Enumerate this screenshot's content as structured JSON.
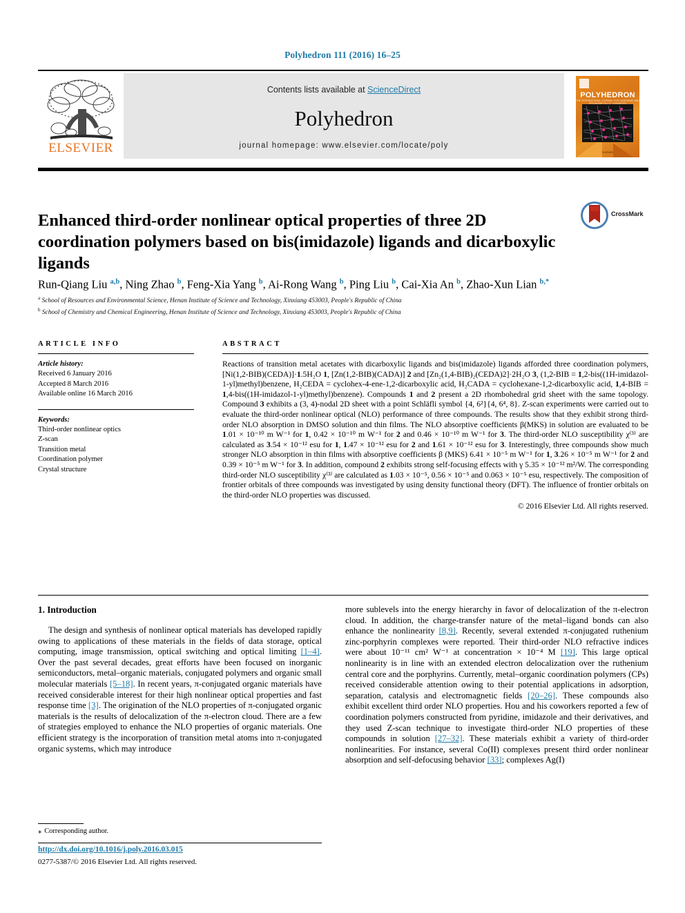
{
  "running_head": "Polyhedron 111 (2016) 16–25",
  "masthead": {
    "contents_prefix": "Contents lists available at ",
    "sciencedirect": "ScienceDirect",
    "journal_name": "Polyhedron",
    "homepage": "journal homepage: www.elsevier.com/locate/poly",
    "publisher_wordmark": "ELSEVIER",
    "cover": {
      "title": "POLYHEDRON",
      "subtitle": "THE INTERNATIONAL JOURNAL FOR INORGANIC AND ORGANOMETALLIC CHEMISTRY",
      "footer": "ELSEVIER"
    },
    "accent_color": "#1f7aa8",
    "panel_color": "#e6e6e6",
    "elsevier_orange": "#e87422"
  },
  "article": {
    "title": "Enhanced third-order nonlinear optical properties of three 2D coordination polymers based on bis(imidazole) ligands and dicarboxylic ligands",
    "crossmark_label": "CrossMark",
    "authors": [
      {
        "name": "Run-Qiang Liu",
        "sup": "a,b",
        "sep": ", "
      },
      {
        "name": "Ning Zhao",
        "sup": "b",
        "sep": ", "
      },
      {
        "name": "Feng-Xia Yang",
        "sup": "b",
        "sep": ", "
      },
      {
        "name": "Ai-Rong Wang",
        "sup": "b",
        "sep": ", "
      },
      {
        "name": "Ping Liu",
        "sup": "b",
        "sep": ", "
      },
      {
        "name": "Cai-Xia An",
        "sup": "b",
        "sep": ", "
      },
      {
        "name": "Zhao-Xun Lian",
        "sup": "b,*",
        "sep": ""
      }
    ],
    "affiliations": [
      {
        "marker": "a",
        "text": "School of Resources and Environmental Science, Henan Institute of Science and Technology, Xinxiang 453003, People's Republic of China"
      },
      {
        "marker": "b",
        "text": "School of Chemistry and Chemical Engineering, Henan Institute of Science and Technology, Xinxiang 453003, People's Republic of China"
      }
    ]
  },
  "article_info": {
    "heading": "ARTICLE INFO",
    "history_label": "Article history:",
    "history": [
      "Received 6 January 2016",
      "Accepted 8 March 2016",
      "Available online 16 March 2016"
    ],
    "keywords_label": "Keywords:",
    "keywords": [
      "Third-order nonlinear optics",
      "Z-scan",
      "Transition metal",
      "Coordination polymer",
      "Crystal structure"
    ]
  },
  "abstract": {
    "heading": "ABSTRACT",
    "body": "Reactions of transition metal acetates with dicarboxylic ligands and bis(imidazole) ligands afforded three coordination polymers, [Ni(1,2-BIB)(CEDA)]·1.5H₂O 1, [Zn(1,2-BIB)(CADA)] 2 and [Zn₂(1,4-BIB)₂(CEDA)2]·2H₂O 3, (1,2-BIB = 1,2-bis((1H-imidazol-1-yl)methyl)benzene, H₂CEDA = cyclohex-4-ene-1,2-dicarboxylic acid, H₂CADA = cyclohexane-1,2-dicarboxylic acid, 1,4-BIB = 1,4-bis((1H-imidazol-1-yl)methyl)benzene). Compounds 1 and 2 present a 2D rhombohedral grid sheet with the same topology. Compound 3 exhibits a (3, 4)-nodal 2D sheet with a point Schläfli symbol {4, 6²}{4, 6⁴, 8}. Z-scan experiments were carried out to evaluate the third-order nonlinear optical (NLO) performance of three compounds. The results show that they exhibit strong third-order NLO absorption in DMSO solution and thin films. The NLO absorptive coefficients β(MKS) in solution are evaluated to be 1.01 × 10⁻¹⁰ m W⁻¹ for 1, 0.42 × 10⁻¹⁰ m W⁻¹ for 2 and 0.46 × 10⁻¹⁰ m W⁻¹ for 3. The third-order NLO susceptibility χ⁽³⁾ are calculated as 3.54 × 10⁻¹² esu for 1, 1.47 × 10⁻¹² esu for 2 and 1.61 × 10⁻¹² esu for 3. Interestingly, three compounds show much stronger NLO absorption in thin films with absorptive coefficients β (MKS) 6.41 × 10⁻⁵ m W⁻¹ for 1, 3.26 × 10⁻⁵ m W⁻¹ for 2 and 0.39 × 10⁻⁵ m W⁻¹ for 3. In addition, compound 2 exhibits strong self-focusing effects with γ 5.35 × 10⁻¹² m²/W. The corresponding third-order NLO susceptibility χ⁽³⁾ are calculated as 1.03 × 10⁻⁵, 0.56 × 10⁻⁵ and 0.063 × 10⁻⁵ esu, respectively. The composition of frontier orbitals of three compounds was investigated by using density functional theory (DFT). The influence of frontier orbitals on the third-order NLO properties was discussed.",
    "copyright": "© 2016 Elsevier Ltd. All rights reserved."
  },
  "introduction": {
    "heading": "1. Introduction",
    "left_paragraph_1": "The design and synthesis of nonlinear optical materials has developed rapidly owing to applications of these materials in the fields of data storage, optical computing, image transmission, optical switching and optical limiting [1–4]. Over the past several decades, great efforts have been focused on inorganic semiconductors, metal–organic materials, conjugated polymers and organic small molecular materials [5–18]. In recent years, π-conjugated organic materials have received considerable interest for their high nonlinear optical properties and fast response time [3]. The origination of the NLO properties of π-conjugated organic materials is the results of delocalization of the π-electron cloud. There are a few of strategies employed to enhance the NLO properties of organic materials. One efficient strategy is the incorporation of transition metal atoms into π-conjugated organic systems, which may introduce",
    "right_paragraph_1": "more sublevels into the energy hierarchy in favor of delocalization of the π-electron cloud. In addition, the charge-transfer nature of the metal–ligand bonds can also enhance the nonlinearity [8,9]. Recently, several extended π-conjugated ruthenium zinc-porphyrin complexes were reported. Their third-order NLO refractive indices were about 10⁻¹¹ cm² W⁻¹ at concentration × 10⁻⁴ M [19]. This large optical nonlinearity is in line with an extended electron delocalization over the ruthenium central core and the porphyrins. Currently, metal–organic coordination polymers (CPs) received considerable attention owing to their potential applications in adsorption, separation, catalysis and electromagnetic fields [20–26]. These compounds also exhibit excellent third order NLO properties. Hou and his coworkers reported a few of coordination polymers constructed from pyridine, imidazole and their derivatives, and they used Z-scan technique to investigate third-order NLO properties of these compounds in solution [27–32]. These materials exhibit a variety of third-order nonlinearities. For instance, several Co(II) complexes present third order nonlinear absorption and self-defocusing behavior [33]; complexes Ag(I)"
  },
  "footer": {
    "corresponding_author": "Corresponding author.",
    "doi": "http://dx.doi.org/10.1016/j.poly.2016.03.015",
    "issn_line": "0277-5387/© 2016 Elsevier Ltd. All rights reserved."
  }
}
